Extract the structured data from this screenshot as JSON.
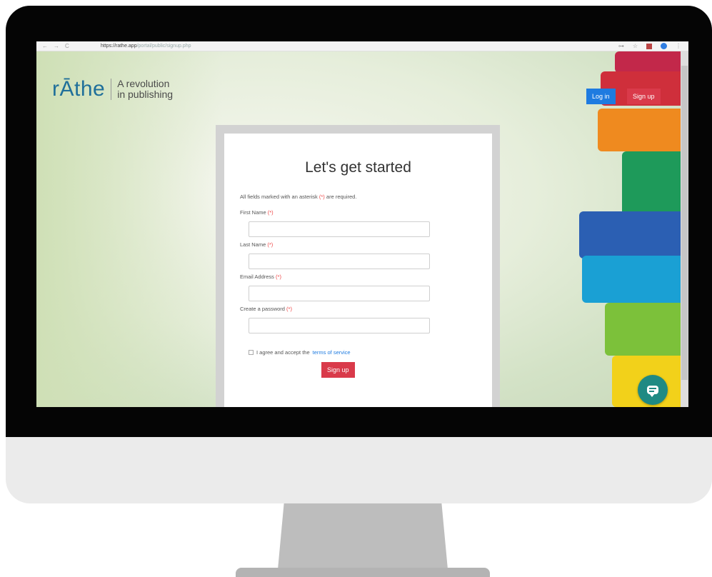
{
  "browser": {
    "nav_back": "←",
    "nav_forward": "→",
    "nav_reload": "C",
    "url_host": "https://rathe.app",
    "url_path": "/portal/public/signup.php",
    "icon_key": "⊶",
    "icon_star": "☆"
  },
  "brand": {
    "logo_text": "rĀthe",
    "tagline_line1": "A revolution",
    "tagline_line2": "in publishing"
  },
  "header": {
    "login_label": "Log in",
    "signup_label": "Sign up"
  },
  "form": {
    "title": "Let's get started",
    "required_note_prefix": "All fields marked with an asterisk",
    "required_note_star": "(*)",
    "required_note_suffix": "are required.",
    "fields": [
      {
        "label": "First Name",
        "star": "(*)",
        "value": ""
      },
      {
        "label": "Last Name",
        "star": "(*)",
        "value": ""
      },
      {
        "label": "Email Address",
        "star": "(*)",
        "value": ""
      },
      {
        "label": "Create a password",
        "star": "(*)",
        "value": ""
      }
    ],
    "agree_prefix": "I agree and accept the",
    "agree_link": "terms of service",
    "submit_label": "Sign up"
  },
  "colors": {
    "accent_blue": "#1e7be0",
    "accent_red": "#d93a4a",
    "brand_blue": "#1f6f9a",
    "chat_teal": "#1f8a83"
  },
  "icons": {
    "chat": "chat-icon"
  }
}
